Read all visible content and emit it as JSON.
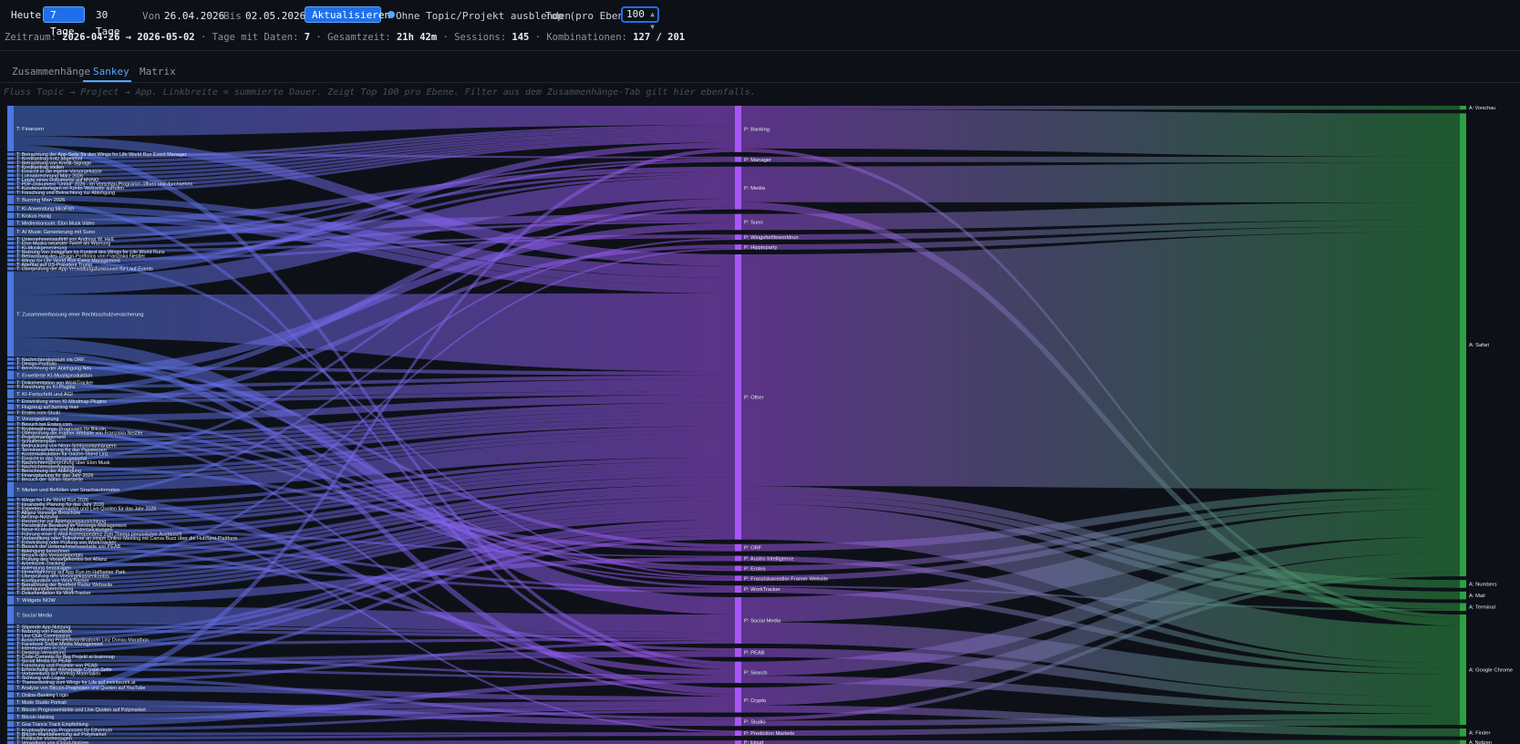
{
  "toolbar": {
    "today": "Heute",
    "seven_days": "7 Tage",
    "thirty_days": "30 Tage",
    "from_label": "Von",
    "from_value": "26.04.2026",
    "to_label": "Bis",
    "to_value": "02.05.2026",
    "refresh": "Aktualisieren",
    "hide_label": "Ohne Topic/Projekt ausblenden",
    "top_label": "Top (pro Ebene)",
    "top_value": "100",
    "accent": "#1f6feb"
  },
  "summary": {
    "range_label": "Zeitraum:",
    "range_value": "2026-04-26 → 2026-05-02",
    "days_label": "· Tage mit Daten:",
    "days_value": "7",
    "total_label": "· Gesamtzeit:",
    "total_value": "21h 42m",
    "sessions_label": "· Sessions:",
    "sessions_value": "145",
    "combos_label": "· Kombinationen:",
    "combos_value": "127 / 201"
  },
  "tabs": [
    {
      "label": "Zusammenhänge",
      "active": false
    },
    {
      "label": "Sankey",
      "active": true
    },
    {
      "label": "Matrix",
      "active": false
    }
  ],
  "hint": "Fluss Topic → Project → App. Linkbreite = summierte Dauer. Zeigt Top 100 pro Ebene. Filter aus dem Zusammenhänge-Tab gilt hier ebenfalls.",
  "colors": {
    "topic": "#4a78e0",
    "project": "#a855f7",
    "app": "#2ea043"
  },
  "sankey": {
    "topics": [
      {
        "label": "T: Finanzen",
        "weight": 15
      },
      {
        "label": "T: Betrachtung der App-Seite für den Wings for Life World Run Event Manager",
        "weight": 1
      },
      {
        "label": "T: Kreditantrag trotz abgelehnt",
        "weight": 1
      },
      {
        "label": "T: Betrachtung von Kredit-Signage",
        "weight": 1
      },
      {
        "label": "T: Kreditantrag stellen",
        "weight": 1
      },
      {
        "label": "T: Einsicht in die eigene Vorsorgekasse",
        "weight": 1
      },
      {
        "label": "T: Lohnabrechnung März 2026",
        "weight": 1
      },
      {
        "label": "T: Letzte eines Dokuments auf MVNO",
        "weight": 1
      },
      {
        "label": "T: PDF-Dokument \"Unfall\" 2026 - im Vorschau-Programm öffnen und durchsehen",
        "weight": 1
      },
      {
        "label": "T: Kundenunterlagen im Konto-Webseite aufrufen",
        "weight": 1
      },
      {
        "label": "T: Forschung und Betrachtung zur Ablehgung",
        "weight": 1
      },
      {
        "label": "T: Burning Man 2026",
        "weight": 3
      },
      {
        "label": "T: KI-Anwendung MiroFish",
        "weight": 2
      },
      {
        "label": "T: Krokus Honig",
        "weight": 2
      },
      {
        "label": "T: Medienkonsum: Elon Musk Video",
        "weight": 2
      },
      {
        "label": "T: AI Music Generierung mit Suno",
        "weight": 3
      },
      {
        "label": "T: Unternehmensauftritt von Andreas W. Heß",
        "weight": 1
      },
      {
        "label": "T: Elon Musks neuester Tweet als Warnung",
        "weight": 1
      },
      {
        "label": "T: KI-Musikgenerierung",
        "weight": 1
      },
      {
        "label": "T: Nutzung von Instagram im Kontext des Wings for Life World Runs",
        "weight": 1
      },
      {
        "label": "T: Betrachtung des Design-Portfolios von Franziska Nestler",
        "weight": 1
      },
      {
        "label": "T: Wings for Life World Run Event Management",
        "weight": 1
      },
      {
        "label": "T: Attentat auf US-Präsident Trump",
        "weight": 1
      },
      {
        "label": "T: Überprüfung der App-Verwaltungsfunktionen für Lauf-Events",
        "weight": 1
      },
      {
        "label": "T: Zusammenfassung einer Rechtsschutzversicherung",
        "weight": 28
      },
      {
        "label": "T: Nachrichtenkonsum via ORF",
        "weight": 1
      },
      {
        "label": "T: Design-Portfolio",
        "weight": 1
      },
      {
        "label": "T: Berechnung der Ablehgung Neu",
        "weight": 1
      },
      {
        "label": "T: Erweiterte KI-Musikproduktion",
        "weight": 3
      },
      {
        "label": "T: Dokumentation von WorkTracker",
        "weight": 1
      },
      {
        "label": "T: Forschung zu KI-Plugins",
        "weight": 1
      },
      {
        "label": "T: KI-Fortschritt und AGI",
        "weight": 3
      },
      {
        "label": "T: Entwicklung eines KI-Mindmap-Plugins",
        "weight": 1
      },
      {
        "label": "T: Flugzeug auf burning man",
        "weight": 2
      },
      {
        "label": "T: Erstes.com Sholri",
        "weight": 1
      },
      {
        "label": "T: Vorsorgeplanung",
        "weight": 2
      },
      {
        "label": "T: Besuch bei Erstes.com",
        "weight": 1
      },
      {
        "label": "T: Kryptowährungs-Prognosen für Bitcoin",
        "weight": 1
      },
      {
        "label": "T: Überprüfung der Framer-Website von Franziska Nestler",
        "weight": 1
      },
      {
        "label": "T: Projektmanagement",
        "weight": 1
      },
      {
        "label": "T: Schulferienplan",
        "weight": 1
      },
      {
        "label": "T: Bedruckung von Neon-Schlüsselanhängern",
        "weight": 1
      },
      {
        "label": "T: Terminreservierung für das Passwesen",
        "weight": 1
      },
      {
        "label": "T: Kostenkalkulation für Gastro-Stand Linz",
        "weight": 1
      },
      {
        "label": "T: Einsicht in das Vorsorgeportal",
        "weight": 1
      },
      {
        "label": "T: Nachrichtenüberprüfung über Elon Musk",
        "weight": 1
      },
      {
        "label": "T: Nachrichtenüberfragung",
        "weight": 1
      },
      {
        "label": "T: Berechnung der Ablehgung",
        "weight": 1
      },
      {
        "label": "T: Finanzplanung für das Jahr 2026",
        "weight": 1
      },
      {
        "label": "T: Besuch der Safari-Startseite",
        "weight": 1
      },
      {
        "label": "T: Mieten und Befüllen von Snackautomaten",
        "weight": 5
      },
      {
        "label": "T: Wings for Life World Run 2026",
        "weight": 1
      },
      {
        "label": "T: Finanzielle Planung für das Jahr 2026",
        "weight": 1
      },
      {
        "label": "T: Experten-Prognosemärkte und Live-Quoten für das Jahr 2026",
        "weight": 1
      },
      {
        "label": "T: Allianz Vorsorge Broschüre",
        "weight": 1
      },
      {
        "label": "T: AirDrop-Nutzung",
        "weight": 1
      },
      {
        "label": "T: Recherche zur Ablehgungsausrichtung",
        "weight": 1
      },
      {
        "label": "T: Persönliche Beratung im Vorsorge-Management",
        "weight": 1
      },
      {
        "label": "T: Neue KI-Modelle und Marktentwicklungen",
        "weight": 1
      },
      {
        "label": "T: Führung einer E-Mail-Korrespondenz zum Thema persönlicher Austausch",
        "weight": 1
      },
      {
        "label": "T: Vorbereitung oder Teilnahme an einem Online-Meeting mit Canva Buzz über die HubSpot-Plattform",
        "weight": 1
      },
      {
        "label": "T: Entwicklung oder Prüfung von WorkTracker",
        "weight": 1
      },
      {
        "label": "T: Besuch der Unternehmenswebsite von PEAB",
        "weight": 1
      },
      {
        "label": "T: Ablehgung berechnen",
        "weight": 1
      },
      {
        "label": "T: Besuch des Vorsorgeportals",
        "weight": 1
      },
      {
        "label": "T: Prüfung des Vorsorgekontos bei Allianz",
        "weight": 1
      },
      {
        "label": "T: Arbeitszeit-Tracking",
        "weight": 1
      },
      {
        "label": "T: Ablehgung beantragen",
        "weight": 1
      },
      {
        "label": "T: Firmenfahrzeug auf App Run im Hafhamer Park",
        "weight": 1
      },
      {
        "label": "T: Überprüfung des Vorsorgekassenkontos",
        "weight": 1
      },
      {
        "label": "T: Konfiguration von WorkTracker",
        "weight": 1
      },
      {
        "label": "T: Betrachtung der Breitfeld Radar Webseite",
        "weight": 1
      },
      {
        "label": "T: Ablehgungsberechnung",
        "weight": 1
      },
      {
        "label": "T: Dokumentation für WorkTracker",
        "weight": 1
      },
      {
        "label": "T: Widgets NOW",
        "weight": 3
      },
      {
        "label": "T: Social Media",
        "weight": 6
      },
      {
        "label": "T: Stipende App Nutzung",
        "weight": 1
      },
      {
        "label": "T: Nutzung von Facebook",
        "weight": 1
      },
      {
        "label": "T: Linz Club Commission",
        "weight": 1
      },
      {
        "label": "T: Ausschreibung Projektkoordinator/in Linz Donau Marathon",
        "weight": 1
      },
      {
        "label": "T: Facebook Social Media Management",
        "weight": 1
      },
      {
        "label": "T: Interessantes in Linz",
        "weight": 1
      },
      {
        "label": "T: Desktop-Verwaltung",
        "weight": 1
      },
      {
        "label": "T: Code-Commits für das Projekt ai-brainmap",
        "weight": 1
      },
      {
        "label": "T: Social Media für PEAB",
        "weight": 1
      },
      {
        "label": "T: Forschung und Projekte von PEAB",
        "weight": 1
      },
      {
        "label": "T: Erforschung der Homepage-Crystal-Seite",
        "weight": 1
      },
      {
        "label": "T: Vorbereitung auf Vortrag-Materialien",
        "weight": 1
      },
      {
        "label": "T: Sichtung von Logos",
        "weight": 1
      },
      {
        "label": "T: Themenbeitrag zum Wings for Life auf meinbezirk.at",
        "weight": 1
      },
      {
        "label": "T: Analyse von Bitcoin-Prognosen und Quoten auf YouTube",
        "weight": 2
      },
      {
        "label": "T: Online-Banking Login",
        "weight": 2
      },
      {
        "label": "T: Mode Studio Portrait",
        "weight": 2
      },
      {
        "label": "T: Bitcoin Prognosemärkte und Live-Quoten auf Polymarket",
        "weight": 2
      },
      {
        "label": "T: Bitcoin Halving",
        "weight": 2
      },
      {
        "label": "T: Goa Trance Track Empfehlung",
        "weight": 2
      },
      {
        "label": "T: Kryptowährungs-Prognosen für Ethereum",
        "weight": 1
      },
      {
        "label": "T: Bitcoin-Markbewertung auf Polymarket",
        "weight": 1
      },
      {
        "label": "T: Politische Vorhersagen",
        "weight": 1
      },
      {
        "label": "T: Verwaltung von iCloud-Notizen",
        "weight": 1
      }
    ],
    "projects": [
      {
        "label": "P: Banking",
        "weight": 26
      },
      {
        "label": "P: Manager",
        "weight": 3
      },
      {
        "label": "P: Media",
        "weight": 24
      },
      {
        "label": "P: Suno",
        "weight": 9
      },
      {
        "label": "P: Wingsforlifeworldrun",
        "weight": 3
      },
      {
        "label": "P: Hippieparty",
        "weight": 3
      },
      {
        "label": "P: Other",
        "weight": 160
      },
      {
        "label": "P: ORF",
        "weight": 4
      },
      {
        "label": "P: Austro Intelligence",
        "weight": 3
      },
      {
        "label": "P: Erstes",
        "weight": 3
      },
      {
        "label": "P: Franziskanestler Framer Website",
        "weight": 3
      },
      {
        "label": "P: WorkTracker",
        "weight": 4
      },
      {
        "label": "P: Social Media",
        "weight": 26
      },
      {
        "label": "P: PEAB",
        "weight": 5
      },
      {
        "label": "P: Search",
        "weight": 12
      },
      {
        "label": "P: Crypto",
        "weight": 14
      },
      {
        "label": "P: Studio",
        "weight": 5
      },
      {
        "label": "P: Prediction Markets",
        "weight": 3
      },
      {
        "label": "P: Icloud",
        "weight": 2
      }
    ],
    "apps": [
      {
        "label": "A: Vorschau",
        "weight": 2
      },
      {
        "label": "A: Safari",
        "weight": 235
      },
      {
        "label": "A: Numbers",
        "weight": 4
      },
      {
        "label": "A: Mail",
        "weight": 4
      },
      {
        "label": "A: Terminal",
        "weight": 4
      },
      {
        "label": "A: Google Chrome",
        "weight": 56
      },
      {
        "label": "A: Finder",
        "weight": 4
      },
      {
        "label": "A: Notizen",
        "weight": 2
      }
    ],
    "links_tp": [
      [
        0,
        0,
        10
      ],
      [
        1,
        1,
        1
      ],
      [
        2,
        0,
        1
      ],
      [
        3,
        0,
        1
      ],
      [
        4,
        0,
        1
      ],
      [
        5,
        0,
        1
      ],
      [
        6,
        0,
        1
      ],
      [
        7,
        0,
        1
      ],
      [
        8,
        0,
        1
      ],
      [
        9,
        0,
        1
      ],
      [
        10,
        0,
        1
      ],
      [
        0,
        6,
        3
      ],
      [
        11,
        6,
        3
      ],
      [
        12,
        6,
        2
      ],
      [
        13,
        6,
        2
      ],
      [
        14,
        2,
        2
      ],
      [
        15,
        3,
        3
      ],
      [
        16,
        1,
        1
      ],
      [
        17,
        2,
        1
      ],
      [
        18,
        3,
        1
      ],
      [
        19,
        4,
        1
      ],
      [
        20,
        10,
        1
      ],
      [
        21,
        4,
        1
      ],
      [
        22,
        2,
        1
      ],
      [
        23,
        1,
        1
      ],
      [
        24,
        6,
        20
      ],
      [
        24,
        2,
        8
      ],
      [
        25,
        7,
        1
      ],
      [
        26,
        10,
        1
      ],
      [
        27,
        6,
        1
      ],
      [
        28,
        3,
        3
      ],
      [
        29,
        11,
        1
      ],
      [
        30,
        6,
        1
      ],
      [
        31,
        2,
        3
      ],
      [
        32,
        6,
        1
      ],
      [
        33,
        5,
        2
      ],
      [
        34,
        9,
        1
      ],
      [
        35,
        6,
        2
      ],
      [
        36,
        9,
        1
      ],
      [
        37,
        15,
        1
      ],
      [
        38,
        10,
        1
      ],
      [
        39,
        6,
        1
      ],
      [
        40,
        6,
        1
      ],
      [
        41,
        6,
        1
      ],
      [
        42,
        6,
        1
      ],
      [
        43,
        6,
        1
      ],
      [
        44,
        6,
        1
      ],
      [
        45,
        2,
        1
      ],
      [
        46,
        7,
        1
      ],
      [
        47,
        6,
        1
      ],
      [
        48,
        6,
        1
      ],
      [
        49,
        6,
        1
      ],
      [
        50,
        6,
        5
      ],
      [
        51,
        4,
        1
      ],
      [
        52,
        6,
        1
      ],
      [
        53,
        17,
        1
      ],
      [
        54,
        6,
        1
      ],
      [
        55,
        6,
        1
      ],
      [
        56,
        6,
        1
      ],
      [
        57,
        6,
        1
      ],
      [
        58,
        8,
        1
      ],
      [
        59,
        6,
        1
      ],
      [
        60,
        6,
        1
      ],
      [
        61,
        11,
        1
      ],
      [
        62,
        13,
        1
      ],
      [
        63,
        6,
        1
      ],
      [
        64,
        6,
        1
      ],
      [
        65,
        6,
        1
      ],
      [
        66,
        11,
        1
      ],
      [
        67,
        6,
        1
      ],
      [
        68,
        5,
        1
      ],
      [
        69,
        6,
        1
      ],
      [
        70,
        6,
        1
      ],
      [
        71,
        6,
        1
      ],
      [
        72,
        6,
        1
      ],
      [
        73,
        6,
        1
      ],
      [
        74,
        8,
        3
      ],
      [
        75,
        12,
        6
      ],
      [
        76,
        12,
        1
      ],
      [
        77,
        12,
        1
      ],
      [
        78,
        6,
        1
      ],
      [
        79,
        6,
        1
      ],
      [
        80,
        12,
        1
      ],
      [
        81,
        6,
        1
      ],
      [
        82,
        6,
        1
      ],
      [
        83,
        14,
        1
      ],
      [
        84,
        13,
        1
      ],
      [
        85,
        13,
        1
      ],
      [
        86,
        14,
        1
      ],
      [
        87,
        6,
        1
      ],
      [
        88,
        16,
        1
      ],
      [
        89,
        12,
        1
      ],
      [
        90,
        15,
        2
      ],
      [
        91,
        0,
        2
      ],
      [
        92,
        16,
        2
      ],
      [
        93,
        15,
        2
      ],
      [
        94,
        15,
        2
      ],
      [
        95,
        14,
        2
      ],
      [
        96,
        15,
        1
      ],
      [
        97,
        17,
        1
      ],
      [
        98,
        17,
        1
      ],
      [
        99,
        18,
        1
      ],
      [
        0,
        14,
        2
      ],
      [
        24,
        12,
        6
      ],
      [
        24,
        15,
        3
      ],
      [
        50,
        14,
        3
      ],
      [
        24,
        0,
        3
      ],
      [
        11,
        14,
        2
      ],
      [
        31,
        6,
        3
      ]
    ],
    "links_pa": [
      [
        0,
        1,
        22
      ],
      [
        0,
        0,
        2
      ],
      [
        0,
        5,
        2
      ],
      [
        1,
        1,
        3
      ],
      [
        2,
        1,
        20
      ],
      [
        2,
        5,
        4
      ],
      [
        3,
        1,
        9
      ],
      [
        4,
        1,
        3
      ],
      [
        5,
        1,
        3
      ],
      [
        6,
        1,
        130
      ],
      [
        6,
        5,
        20
      ],
      [
        6,
        2,
        4
      ],
      [
        6,
        3,
        3
      ],
      [
        6,
        4,
        3
      ],
      [
        7,
        1,
        4
      ],
      [
        8,
        5,
        3
      ],
      [
        9,
        1,
        3
      ],
      [
        10,
        1,
        3
      ],
      [
        11,
        4,
        1
      ],
      [
        11,
        5,
        3
      ],
      [
        12,
        1,
        14
      ],
      [
        12,
        5,
        12
      ],
      [
        13,
        5,
        5
      ],
      [
        14,
        1,
        8
      ],
      [
        14,
        5,
        4
      ],
      [
        15,
        1,
        10
      ],
      [
        15,
        6,
        4
      ],
      [
        16,
        5,
        3
      ],
      [
        16,
        1,
        2
      ],
      [
        17,
        5,
        3
      ],
      [
        18,
        7,
        2
      ]
    ]
  }
}
